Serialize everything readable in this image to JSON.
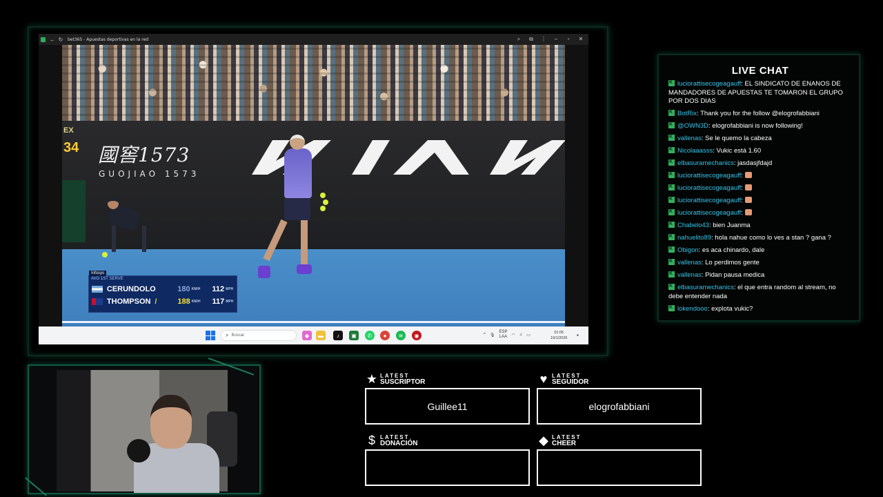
{
  "browser": {
    "tab_title": "bet365 - Apuestas deportivas en la red"
  },
  "video": {
    "sponsor_main": "國窖1573",
    "sponsor_sub": "GUOJIAO 1573",
    "kia_logo": "KIA",
    "clock_brand": "EX",
    "clock_value": "34",
    "scoreboard": {
      "brand": "Infosys",
      "subheader": "AVG 1ST SERVE",
      "rows": [
        {
          "name": "CERUNDOLO",
          "flag_color": "#75aadb",
          "speed": "180",
          "unit": "KM/H",
          "avg": "112",
          "unit2": "MPH",
          "mark": ""
        },
        {
          "name": "THOMPSON",
          "flag_color": "#1f3a8a",
          "speed": "188",
          "unit": "KM/H",
          "avg": "117",
          "unit2": "MPH",
          "mark": "/"
        }
      ]
    }
  },
  "taskbar": {
    "search_placeholder": "Buscar",
    "tray_lang_1": "ESP",
    "tray_lang_2": "LAA",
    "time": "01:05",
    "date": "19/1/2026"
  },
  "chat": {
    "title": "LIVE CHAT",
    "messages": [
      {
        "user": "luciorattisecogeagauff",
        "text": "EL SINDICATO DE ENANOS DE MANDADORES DE APUESTAS TE TOMARON EL GRUPO POR DOS DIAS",
        "emote": false
      },
      {
        "user": "BotRix",
        "text": "Thank you for the follow @elogrofabbiani",
        "emote": false
      },
      {
        "user": "@OWN3D",
        "text": "elogrofabbiani is now following!",
        "emote": false
      },
      {
        "user": "vallenas",
        "text": "Se le quemo la cabeza",
        "emote": false
      },
      {
        "user": "Nicolaaasss",
        "text": "Vukic está 1.60",
        "emote": false
      },
      {
        "user": "elbasuramechanics",
        "text": "jasdasjfdajd",
        "emote": false
      },
      {
        "user": "luciorattisecogeagauff",
        "text": "",
        "emote": true
      },
      {
        "user": "luciorattisecogeagauff",
        "text": "",
        "emote": true
      },
      {
        "user": "luciorattisecogeagauff",
        "text": "",
        "emote": true
      },
      {
        "user": "luciorattisecogeagauff",
        "text": "",
        "emote": true
      },
      {
        "user": "Chabelo43",
        "text": "bien Juanma",
        "emote": false
      },
      {
        "user": "nahuelito89",
        "text": "hola nahue como lo ves a stan ? gana ?",
        "emote": false
      },
      {
        "user": "Obigon",
        "text": "es aca chinardo, dale",
        "emote": false
      },
      {
        "user": "vallenas",
        "text": "Lo perdimos gente",
        "emote": false
      },
      {
        "user": "vallenas",
        "text": "Pidan pausa medica",
        "emote": false
      },
      {
        "user": "elbasuramechanics",
        "text": "el que entra random al stream, no debe entender nada",
        "emote": false
      },
      {
        "user": "lokendooo",
        "text": "explota vukic?",
        "emote": false
      }
    ]
  },
  "latest": {
    "suscriptor": {
      "small": "LATEST",
      "big": "SUSCRIPTOR",
      "value": "Guillee11",
      "icon": "star-icon"
    },
    "seguidor": {
      "small": "LATEST",
      "big": "SEGUIDOR",
      "value": "elogrofabbiani",
      "icon": "heart-icon"
    },
    "donacion": {
      "small": "LATEST",
      "big": "DONACIÓN",
      "value": "",
      "icon": "dollar-icon"
    },
    "cheer": {
      "small": "LATEST",
      "big": "CHEER",
      "value": "",
      "icon": "diamond-icon"
    }
  },
  "colors": {
    "accent_green": "#2fb25e",
    "chat_username": "#37c3e6",
    "frame_glow": "#0f5a44"
  }
}
